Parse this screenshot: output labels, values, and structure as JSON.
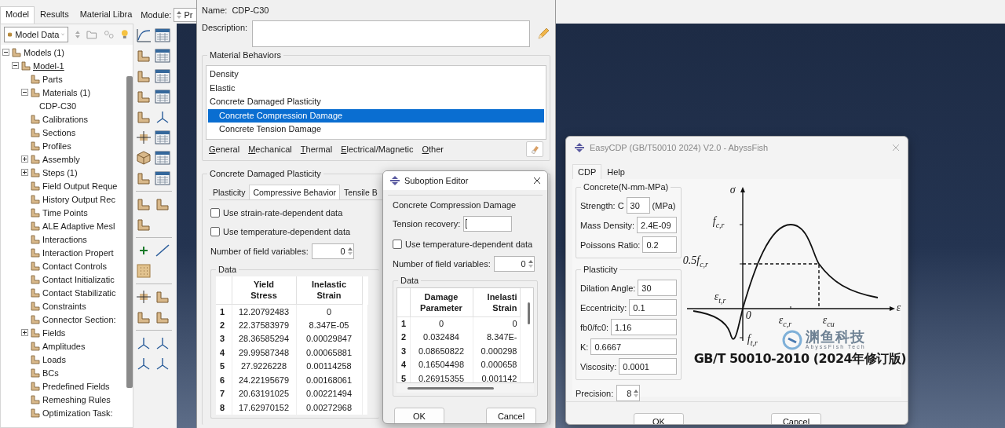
{
  "left_panel": {
    "tabs": [
      {
        "label": "Model",
        "selected": true
      },
      {
        "label": "Results",
        "selected": false
      },
      {
        "label": "Material Libra",
        "selected": false
      }
    ],
    "module": {
      "label": "Module:",
      "value": "Pr"
    },
    "tree_selector": {
      "value": "Model Data"
    },
    "tree": [
      {
        "label": "Models (1)",
        "expanded": true,
        "children": [
          {
            "label": "Model-1",
            "expanded": true,
            "current": true,
            "children": [
              {
                "label": "Parts"
              },
              {
                "label": "Materials (1)",
                "expanded": true,
                "children": [
                  {
                    "label": "CDP-C30"
                  }
                ]
              },
              {
                "label": "Calibrations"
              },
              {
                "label": "Sections"
              },
              {
                "label": "Profiles"
              },
              {
                "label": "Assembly",
                "expanded": false
              },
              {
                "label": "Steps (1)",
                "expanded": false
              },
              {
                "label": "Field Output Reque"
              },
              {
                "label": "History Output Rec"
              },
              {
                "label": "Time Points"
              },
              {
                "label": "ALE Adaptive Mesl"
              },
              {
                "label": "Interactions"
              },
              {
                "label": "Interaction Propert"
              },
              {
                "label": "Contact Controls"
              },
              {
                "label": "Contact Initializatic"
              },
              {
                "label": "Contact Stabilizatic"
              },
              {
                "label": "Constraints"
              },
              {
                "label": "Connector Section:"
              },
              {
                "label": "Fields",
                "expanded": false
              },
              {
                "label": "Amplitudes"
              },
              {
                "label": "Loads"
              },
              {
                "label": "BCs"
              },
              {
                "label": "Predefined Fields"
              },
              {
                "label": "Remeshing Rules"
              },
              {
                "label": "Optimization Task:"
              }
            ]
          }
        ]
      }
    ]
  },
  "material_editor": {
    "name_label": "Name:",
    "name": "CDP-C30",
    "description_label": "Description:",
    "behaviors_title": "Material Behaviors",
    "behaviors": [
      {
        "label": "Density",
        "selected": false
      },
      {
        "label": "Elastic",
        "selected": false
      },
      {
        "label": "Concrete Damaged Plasticity",
        "selected": false,
        "children": [
          {
            "label": "Concrete Compression Damage",
            "selected": true
          },
          {
            "label": "Concrete Tension Damage",
            "selected": false
          }
        ]
      }
    ],
    "menus": [
      "General",
      "Mechanical",
      "Thermal",
      "Electrical/Magnetic",
      "Other"
    ],
    "section_title": "Concrete Damaged Plasticity",
    "tabs": [
      {
        "label": "Plasticity",
        "selected": false
      },
      {
        "label": "Compressive Behavior",
        "selected": true
      },
      {
        "label": "Tensile B",
        "selected": false
      }
    ],
    "options": [
      {
        "label": "Use strain-rate-dependent data",
        "checked": false
      },
      {
        "label": "Use temperature-dependent data",
        "checked": false
      }
    ],
    "field_variables": {
      "label": "Number of field variables:",
      "value": "0"
    },
    "data": {
      "title": "Data",
      "columns": [
        "Yield\nStress",
        "Inelastic\nStrain"
      ],
      "rows": [
        {
          "number": "1",
          "cells": [
            "12.20792483",
            "0"
          ]
        },
        {
          "number": "2",
          "cells": [
            "22.37583979",
            "8.347E-05"
          ]
        },
        {
          "number": "3",
          "cells": [
            "28.36585294",
            "0.00029847"
          ]
        },
        {
          "number": "4",
          "cells": [
            "29.99587348",
            "0.00065881"
          ]
        },
        {
          "number": "5",
          "cells": [
            "27.9226228",
            "0.00114258"
          ]
        },
        {
          "number": "6",
          "cells": [
            "24.22195679",
            "0.00168061"
          ]
        },
        {
          "number": "7",
          "cells": [
            "20.63191025",
            "0.00221494"
          ]
        },
        {
          "number": "8",
          "cells": [
            "17.62970152",
            "0.00272968"
          ]
        }
      ]
    }
  },
  "suboption_editor": {
    "title": "Suboption Editor",
    "section_title": "Concrete Compression Damage",
    "tension_recovery_label": "Tension recovery:",
    "options": [
      {
        "label": "Use temperature-dependent data",
        "checked": false
      }
    ],
    "field_variables": {
      "label": "Number of field variables:",
      "value": "0"
    },
    "data": {
      "title": "Data",
      "columns": [
        "Damage\nParameter",
        "Inelasti\nStrain"
      ],
      "rows": [
        {
          "number": "1",
          "cells": [
            "0",
            "0"
          ]
        },
        {
          "number": "2",
          "cells": [
            "0.032484",
            "8.347E-"
          ]
        },
        {
          "number": "3",
          "cells": [
            "0.08650822",
            "0.000298"
          ]
        },
        {
          "number": "4",
          "cells": [
            "0.16504498",
            "0.000658"
          ]
        },
        {
          "number": "5",
          "cells": [
            "0.26915355",
            "0.001142"
          ]
        }
      ]
    },
    "buttons": [
      "OK",
      "Cancel"
    ]
  },
  "cdp_dialog": {
    "title": "EasyCDP (GB/T50010 2024) V2.0 - AbyssFish",
    "tabs": [
      {
        "label": "CDP",
        "selected": true
      },
      {
        "label": "Help",
        "selected": false
      }
    ],
    "concrete": {
      "title": "Concrete(N-mm-MPa)",
      "strength_label": "Strength:",
      "strength_prefix": "C",
      "strength": "30",
      "strength_unit": "(MPa)",
      "density_label": "Mass Density:",
      "density": "2.4E-09",
      "poisson_label": "Poissons Ratio:",
      "poisson": "0.2"
    },
    "plasticity": {
      "title": "Plasticity",
      "fields": [
        {
          "label": "Dilation Angle:",
          "value": "30"
        },
        {
          "label": "Eccentricity:",
          "value": "0.1"
        },
        {
          "label": "fb0/fc0:",
          "value": "1.16"
        },
        {
          "label": "K:",
          "value": "0.6667"
        },
        {
          "label": "Viscosity:",
          "value": "0.0001"
        }
      ]
    },
    "precision": {
      "label": "Precision:",
      "value": "8"
    },
    "diagram": {
      "labels": [
        {
          "kind": "y_axis",
          "text": "σ"
        },
        {
          "kind": "peak",
          "text": "f$_{c,r}$"
        },
        {
          "kind": "half_peak",
          "text": "0.5f$_{c,r}$"
        },
        {
          "kind": "tension_strain",
          "text": "ε$_{t,r}$"
        },
        {
          "kind": "origin",
          "text": "0"
        },
        {
          "kind": "peak_strain",
          "text": "ε$_{c,r}$"
        },
        {
          "kind": "ultimate_strain",
          "text": "ε$_{cu}$"
        },
        {
          "kind": "x_axis",
          "text": "ε"
        },
        {
          "kind": "tension_strength",
          "text": "f$_{t,r}$"
        }
      ],
      "logo_name": "渊鱼科技",
      "logo_subtitle": "AbyssFish Tech",
      "caption": "GB/T 50010-2010 (2024年修订版)"
    },
    "buttons": [
      "OK",
      "Cancel"
    ]
  }
}
